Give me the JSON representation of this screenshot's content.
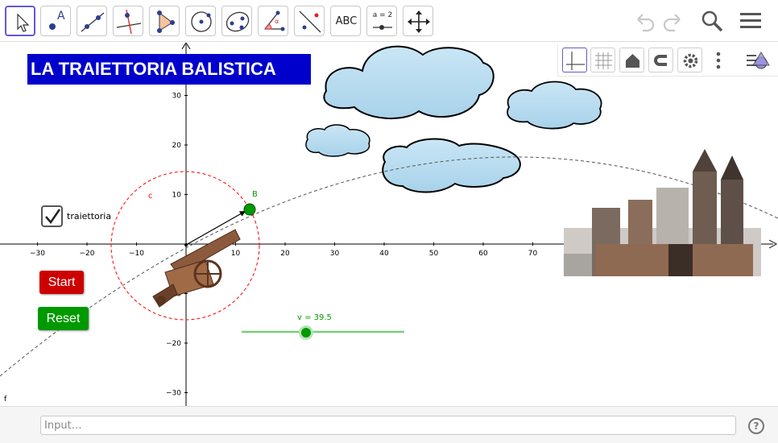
{
  "toolbar": {
    "tools": [
      {
        "name": "move-tool",
        "label": ""
      },
      {
        "name": "point-tool",
        "label": "A"
      },
      {
        "name": "line-tool",
        "label": ""
      },
      {
        "name": "perpendicular-line-tool",
        "label": ""
      },
      {
        "name": "polygon-tool",
        "label": ""
      },
      {
        "name": "circle-tool",
        "label": ""
      },
      {
        "name": "ellipse-tool",
        "label": ""
      },
      {
        "name": "angle-tool",
        "label": "α"
      },
      {
        "name": "reflect-tool",
        "label": ""
      },
      {
        "name": "text-tool",
        "label": "ABC"
      },
      {
        "name": "slider-tool",
        "label": "a = 2"
      },
      {
        "name": "move-graphics-tool",
        "label": ""
      }
    ]
  },
  "graphics": {
    "title": "LA TRAIETTORIA  BALISTICA",
    "x_ticks": [
      "−30",
      "−20",
      "−10",
      "10",
      "20",
      "30",
      "40",
      "50",
      "60",
      "70"
    ],
    "y_ticks": [
      "30",
      "20",
      "10",
      "−10",
      "−20",
      "−30"
    ],
    "circle_label": "c",
    "point_label": "B",
    "curve_label": "f",
    "checkbox": {
      "label": "traiettoria",
      "checked": true
    },
    "start_button": "Start",
    "reset_button": "Reset",
    "slider": {
      "label": "v = 39.5",
      "value": 39.5
    }
  },
  "input_bar": {
    "placeholder": "Input…",
    "help": "?"
  },
  "colors": {
    "title_bg": "#0000cc",
    "start_bg": "#cc0000",
    "reset_bg": "#009900",
    "point_green": "#009900",
    "circle_red": "#ff0000",
    "tool_active": "#6557d2"
  }
}
